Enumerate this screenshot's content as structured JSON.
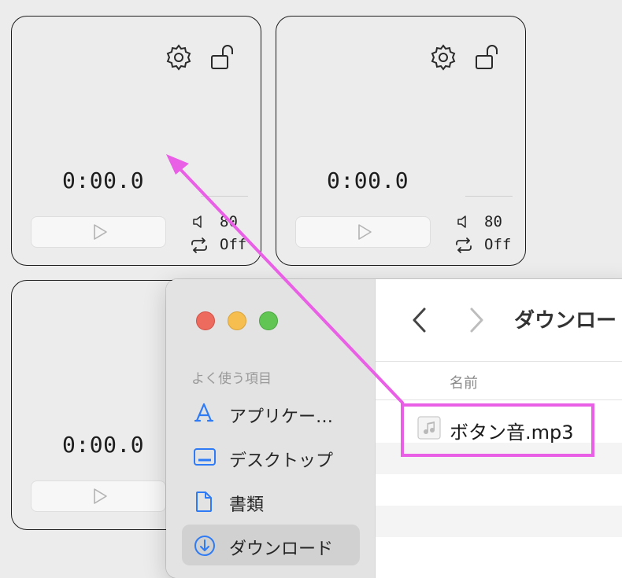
{
  "pads": [
    {
      "time": "0:00.0",
      "volume": "80",
      "loop": "Off",
      "show_controls": true
    },
    {
      "time": "0:00.0",
      "volume": "80",
      "loop": "Off",
      "show_controls": true
    },
    {
      "time": "0:00.0",
      "volume": "",
      "loop": "",
      "show_controls": false
    }
  ],
  "finder": {
    "favorites_heading": "よく使う項目",
    "sidebar_items": [
      {
        "label": "アプリケー…",
        "icon": "applications-icon"
      },
      {
        "label": "デスクトップ",
        "icon": "desktop-icon"
      },
      {
        "label": "書類",
        "icon": "documents-icon"
      },
      {
        "label": "ダウンロード",
        "icon": "downloads-icon",
        "selected": true
      }
    ],
    "folder_title": "ダウンロード",
    "column_name": "名前",
    "file": {
      "name": "ボタン音.mp3",
      "icon": "audio-file-icon"
    }
  },
  "colors": {
    "annotation": "#e95fe6",
    "accent_blue": "#2f7bf5"
  }
}
